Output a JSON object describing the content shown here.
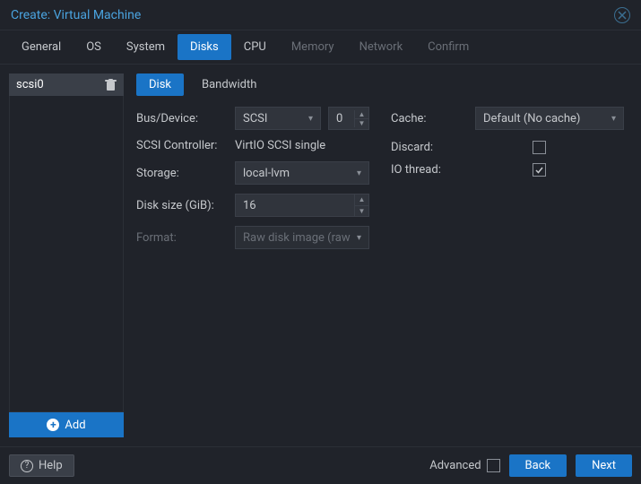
{
  "title": "Create: Virtual Machine",
  "tabs": {
    "general": "General",
    "os": "OS",
    "system": "System",
    "disks": "Disks",
    "cpu": "CPU",
    "memory": "Memory",
    "network": "Network",
    "confirm": "Confirm",
    "active": "disks"
  },
  "sidebar": {
    "items": [
      {
        "id": "scsi0",
        "label": "scsi0"
      }
    ],
    "add_label": "Add"
  },
  "subtabs": {
    "disk": "Disk",
    "bandwidth": "Bandwidth",
    "active": "disk"
  },
  "form": {
    "bus_device": {
      "label": "Bus/Device:",
      "bus": "SCSI",
      "index": "0"
    },
    "scsi_controller": {
      "label": "SCSI Controller:",
      "value": "VirtIO SCSI single"
    },
    "storage": {
      "label": "Storage:",
      "value": "local-lvm"
    },
    "disk_size": {
      "label": "Disk size (GiB):",
      "value": "16"
    },
    "format": {
      "label": "Format:",
      "value": "Raw disk image (raw"
    },
    "cache": {
      "label": "Cache:",
      "value": "Default (No cache)"
    },
    "discard": {
      "label": "Discard:",
      "checked": false
    },
    "io_thread": {
      "label": "IO thread:",
      "checked": true
    }
  },
  "footer": {
    "help": "Help",
    "advanced": "Advanced",
    "advanced_checked": false,
    "back": "Back",
    "next": "Next"
  }
}
